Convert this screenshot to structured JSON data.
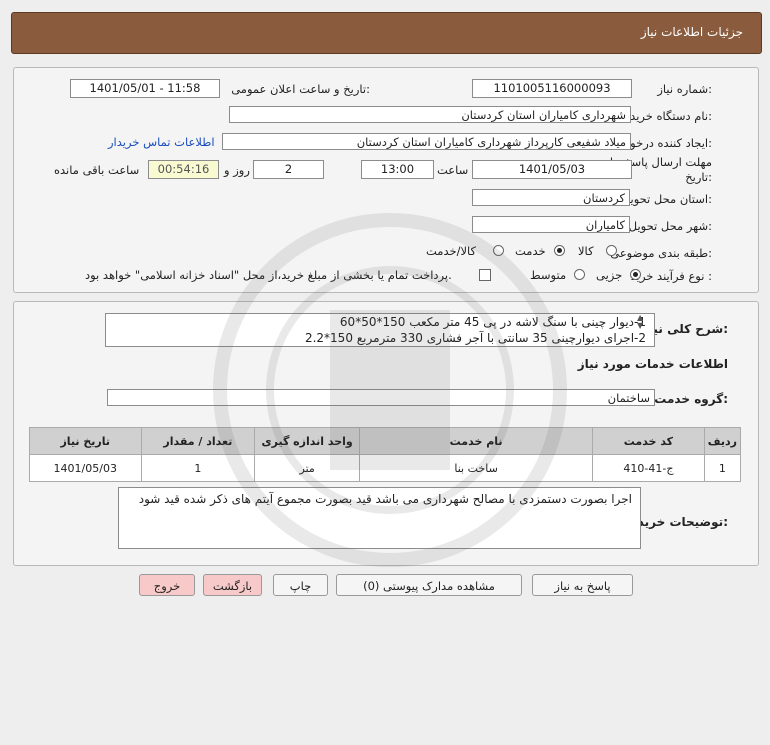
{
  "header": {
    "title": "جزئیات اطلاعات نیاز"
  },
  "form": {
    "need_number_label": "شماره نیاز:",
    "need_number": "1101005116000093",
    "announce_label": "تاریخ و ساعت اعلان عمومی:",
    "announce_value": "1401/05/01 - 11:58",
    "buyer_org_label": "نام دستگاه خریدار:",
    "buyer_org": "شهرداری کامیاران استان کردستان",
    "creator_label": "ایجاد کننده درخواست:",
    "creator": "میلاد شفیعی کارپرداز شهرداری کامیاران استان کردستان",
    "contact_link": "اطلاعات تماس خریدار",
    "deadline_label": "مهلت ارسال پاسخ: تا تاریخ:",
    "deadline_date": "1401/05/03",
    "time_label": "ساعت",
    "deadline_time": "13:00",
    "days_value": "2",
    "days_label": "روز و",
    "remaining_timer": "00:54:16",
    "remaining_label": "ساعت باقی مانده",
    "province_label": "استان محل تحویل:",
    "province": "کردستان",
    "city_label": "شهر محل تحویل:",
    "city": "کامیاران",
    "category_label": "طبقه بندی موضوعی:",
    "category_options": [
      "کالا",
      "خدمت",
      "کالا/خدمت"
    ],
    "category_selected": "خدمت",
    "process_label": "نوع فرآیند خرید :",
    "process_options": [
      "جزیی",
      "متوسط"
    ],
    "process_selected": "جزیی",
    "payment_note": "پرداخت تمام یا بخشی از مبلغ خرید،از محل \"اسناد خزانه اسلامی\" خواهد بود."
  },
  "description": {
    "label": "شرح کلی نیاز:",
    "lines": [
      "1-دیوار چینی با سنگ لاشه در پی 45 متر مکعب 150*50*60",
      "2-اجرای دیوارچینی 35 سانتی با آجر فشاری 330 مترمربع 150*2.2"
    ],
    "services_heading": "اطلاعات خدمات مورد نیاز",
    "service_group_label": "گروه خدمت:",
    "service_group": "ساختمان"
  },
  "table": {
    "headers": [
      "ردیف",
      "کد خدمت",
      "نام خدمت",
      "واحد اندازه گیری",
      "تعداد / مقدار",
      "تاریخ نیاز"
    ],
    "rows": [
      [
        "1",
        "ج-41-410",
        "ساخت بنا",
        "متر",
        "1",
        "1401/05/03"
      ]
    ]
  },
  "buyer_notes": {
    "label": "توضیحات خریدار:",
    "text": "اجرا بصورت دستمزدی با مصالح شهرداری می باشد قید بصورت مجموع آیتم های ذکر شده قید شود"
  },
  "buttons": {
    "reply": "پاسخ به نیاز",
    "attachments": "مشاهده مدارک پیوستی (0)",
    "print": "چاپ",
    "back": "بازگشت",
    "exit": "خروج"
  }
}
